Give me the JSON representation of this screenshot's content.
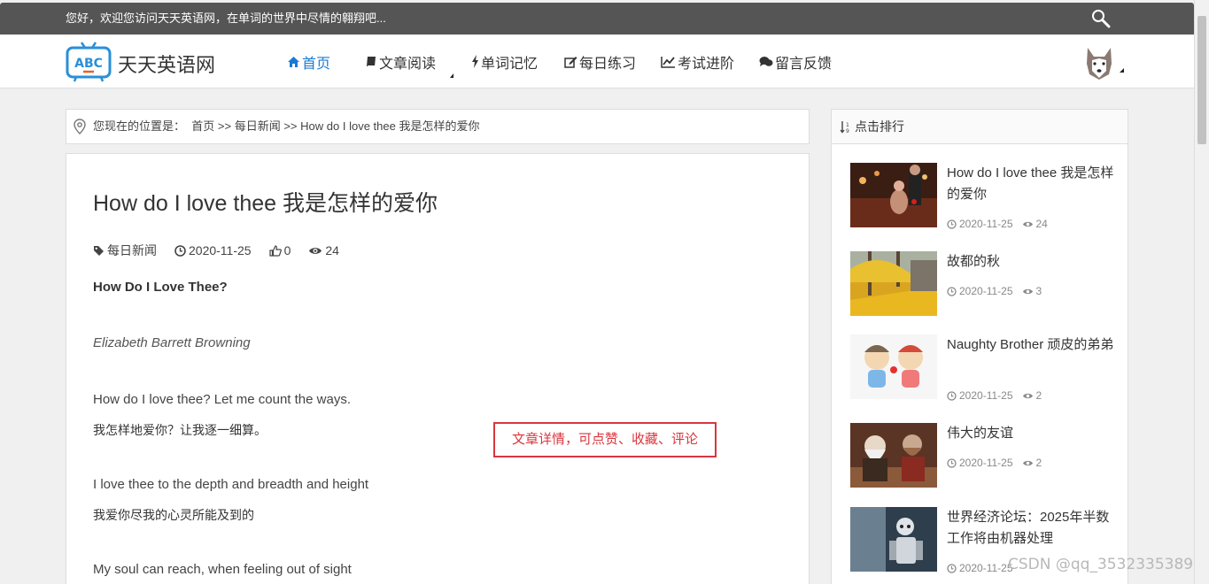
{
  "topbar": {
    "welcome": "您好，欢迎您访问天天英语网，在单词的世界中尽情的翱翔吧..."
  },
  "header": {
    "logo_text": "ABC",
    "site_name": "天天英语网",
    "nav": [
      {
        "label": "首页",
        "icon": "home-icon"
      },
      {
        "label": "文章阅读",
        "icon": "book-icon"
      },
      {
        "label": "单词记忆",
        "icon": "bolt-icon"
      },
      {
        "label": "每日练习",
        "icon": "edit-icon"
      },
      {
        "label": "考试进阶",
        "icon": "line-chart-icon"
      },
      {
        "label": "留言反馈",
        "icon": "comments-icon"
      }
    ]
  },
  "breadcrumb": {
    "prefix": "您现在的位置是：",
    "home": "首页",
    "sep1": ">>",
    "category": "每日新闻",
    "sep2": ">>",
    "current": "How do I love thee 我是怎样的爱你"
  },
  "article": {
    "title": "How do I love thee 我是怎样的爱你",
    "category": "每日新闻",
    "date": "2020-11-25",
    "likes": "0",
    "views": "24",
    "lines": [
      "How Do I Love Thee?",
      "Elizabeth Barrett Browning",
      "How do I love thee? Let me count the ways.",
      "我怎样地爱你？让我逐一细算。",
      "I love thee to the depth and breadth and height",
      "我爱你尽我的心灵所能及到的",
      "My soul can reach, when feeling out of sight"
    ]
  },
  "annotation": "文章详情，可点赞、收藏、评论",
  "sidebar": {
    "title": "点击排行",
    "items": [
      {
        "title": "How do I love thee 我是怎样的爱你",
        "date": "2020-11-25",
        "views": "24"
      },
      {
        "title": "故都的秋",
        "date": "2020-11-25",
        "views": "3"
      },
      {
        "title": "Naughty Brother 顽皮的弟弟",
        "date": "2020-11-25",
        "views": "2"
      },
      {
        "title": "伟大的友谊",
        "date": "2020-11-25",
        "views": "2"
      },
      {
        "title": "世界经济论坛：2025年半数工作将由机器处理",
        "date": "2020-11-25",
        "views": ""
      }
    ]
  },
  "watermark": "CSDN @qq_3532335389"
}
